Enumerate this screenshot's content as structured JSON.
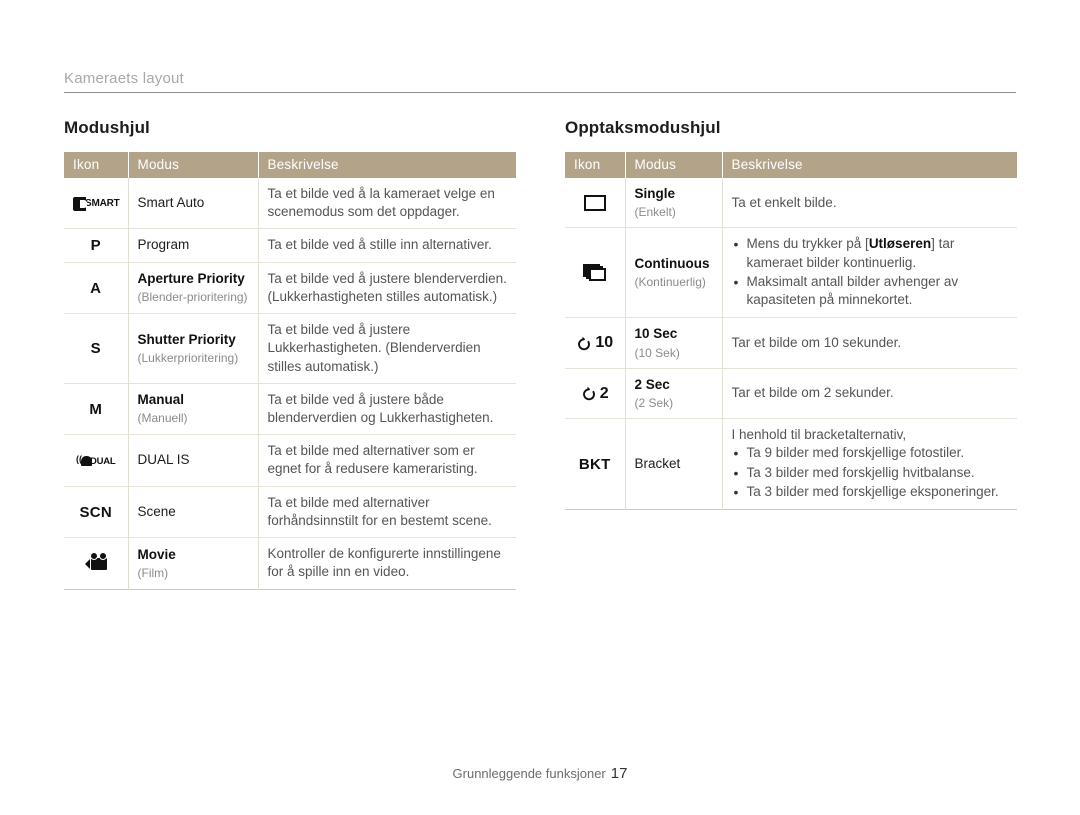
{
  "running_head": "Kameraets layout",
  "footer": {
    "label": "Grunnleggende funksjoner",
    "page_number": "17"
  },
  "colors": {
    "table_header_bg": "#b3a489",
    "table_header_text": "#ffffff",
    "row_divider": "#e8e3d8",
    "table_bottom_border": "#d8c3bd",
    "running_head_text": "#a8a8a8",
    "description_text": "#555555",
    "alt_name_text": "#8b8b8b"
  },
  "sections": [
    {
      "title": "Modushjul",
      "columns": [
        "Ikon",
        "Modus",
        "Beskrivelse"
      ],
      "rows": [
        {
          "icon_name": "smart-auto-icon",
          "icon_text": "SMART",
          "mode": "Smart Auto",
          "mode_alt": "",
          "desc": "Ta et bilde ved å la kameraet velge en scenemodus som det oppdager."
        },
        {
          "icon_name": "program-mode-icon",
          "icon_text": "P",
          "mode": "Program",
          "mode_alt": "",
          "desc": "Ta et bilde ved å stille inn alternativer."
        },
        {
          "icon_name": "aperture-priority-icon",
          "icon_text": "A",
          "mode": "Aperture Priority",
          "mode_alt": "(Blender-prioritering)",
          "desc": "Ta et bilde ved å justere blenderverdien. (Lukkerhastigheten stilles automatisk.)"
        },
        {
          "icon_name": "shutter-priority-icon",
          "icon_text": "S",
          "mode": "Shutter Priority",
          "mode_alt": "(Lukkerprioritering)",
          "desc": "Ta et bilde ved å justere Lukkerhastigheten. (Blenderverdien stilles automatisk.)"
        },
        {
          "icon_name": "manual-mode-icon",
          "icon_text": "M",
          "mode": "Manual",
          "mode_alt": "(Manuell)",
          "desc": "Ta et bilde ved å justere både blenderverdien og Lukkerhastigheten."
        },
        {
          "icon_name": "dual-is-icon",
          "icon_text": "DUAL",
          "mode": "DUAL IS",
          "mode_alt": "",
          "desc": "Ta et bilde med alternativer som er egnet for å redusere kameraristing."
        },
        {
          "icon_name": "scene-mode-icon",
          "icon_text": "SCN",
          "mode": "Scene",
          "mode_alt": "",
          "desc": "Ta et bilde med alternativer forhåndsinnstilt for en bestemt scene."
        },
        {
          "icon_name": "movie-mode-icon",
          "icon_text": "",
          "mode": "Movie",
          "mode_alt": "(Film)",
          "desc": "Kontroller de konfigurerte innstillingene for å spille inn en video."
        }
      ]
    },
    {
      "title": "Opptaksmodushjul",
      "columns": [
        "Ikon",
        "Modus",
        "Beskrivelse"
      ],
      "rows": [
        {
          "icon_name": "single-shot-icon",
          "icon_text": "",
          "mode": "Single",
          "mode_alt": "(Enkelt)",
          "desc": "Ta et enkelt bilde."
        },
        {
          "icon_name": "continuous-shot-icon",
          "icon_text": "",
          "mode": "Continuous",
          "mode_alt": "(Kontinuerlig)",
          "desc_lead": "",
          "desc_bullets": [
            "Mens du trykker på [Utløseren] tar kameraet bilder kontinuerlig.",
            "Maksimalt antall bilder avhenger av kapasiteten på minnekortet."
          ],
          "desc_bullet_bold": "Utløseren"
        },
        {
          "icon_name": "timer-10sec-icon",
          "icon_text": "10",
          "mode": "10 Sec",
          "mode_alt": "(10 Sek)",
          "desc": "Tar et bilde om 10 sekunder."
        },
        {
          "icon_name": "timer-2sec-icon",
          "icon_text": "2",
          "mode": "2 Sec",
          "mode_alt": "(2 Sek)",
          "desc": "Tar et bilde om 2 sekunder."
        },
        {
          "icon_name": "bracket-icon",
          "icon_text": "BKT",
          "mode": "Bracket",
          "mode_alt": "",
          "desc_lead": "I henhold til bracketalternativ,",
          "desc_bullets": [
            "Ta 9 bilder med forskjellige fotostiler.",
            "Ta 3 bilder med forskjellig hvitbalanse.",
            "Ta 3 bilder med forskjellige eksponeringer."
          ]
        }
      ]
    }
  ]
}
